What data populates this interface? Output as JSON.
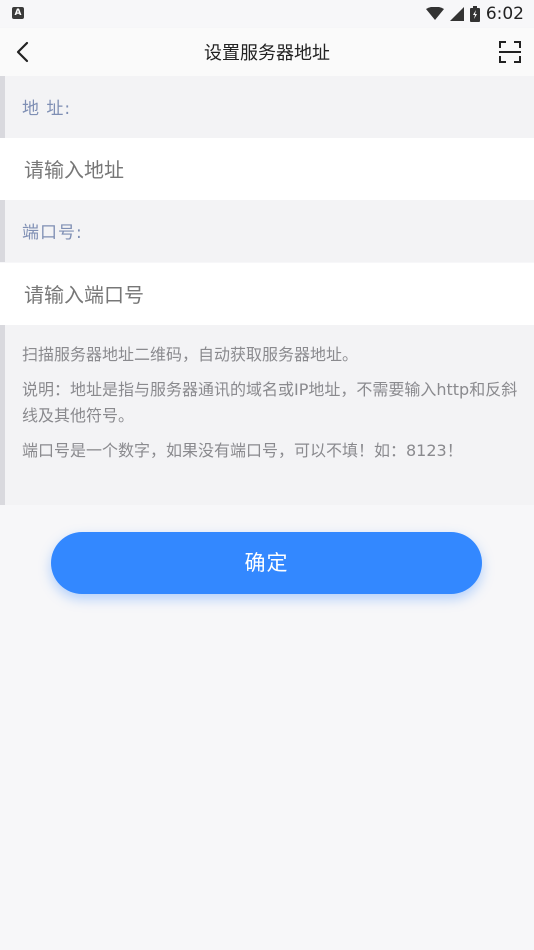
{
  "status_bar": {
    "notification_badge": "A",
    "time": "6:02",
    "icons": [
      "wifi-icon",
      "signal-icon",
      "battery-icon"
    ]
  },
  "header": {
    "title": "设置服务器地址",
    "back_icon": "chevron-left-icon",
    "scan_icon": "scan-icon"
  },
  "address": {
    "label": "地 址:",
    "placeholder": "请输入地址",
    "value": ""
  },
  "port": {
    "label": "端口号:",
    "placeholder": "请输入端口号",
    "value": ""
  },
  "notes": [
    "扫描服务器地址二维码，自动获取服务器地址。",
    "说明：地址是指与服务器通讯的域名或IP地址，不需要输入http和反斜线及其他符号。",
    "端口号是一个数字，如果没有端口号，可以不填！如：8123！"
  ],
  "confirm_button": "确定",
  "colors": {
    "accent": "#3388ff",
    "label": "#7f8fb4",
    "background": "#f7f7f9"
  }
}
